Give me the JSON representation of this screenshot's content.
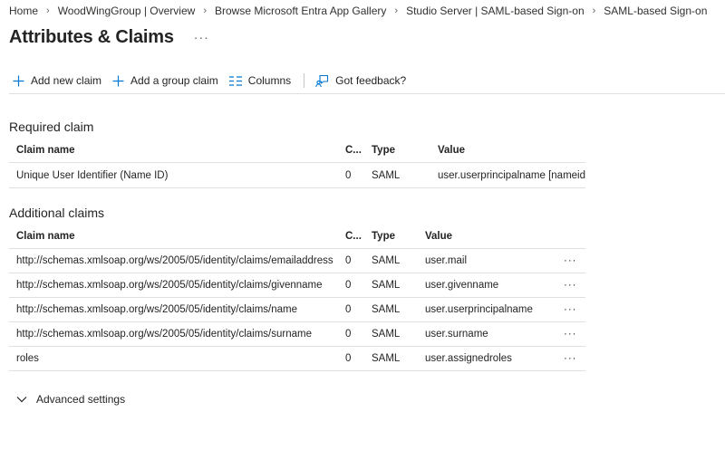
{
  "breadcrumb": [
    "Home",
    "WoodWingGroup | Overview",
    "Browse Microsoft Entra App Gallery",
    "Studio Server | SAML-based Sign-on",
    "SAML-based Sign-on"
  ],
  "page": {
    "title": "Attributes & Claims",
    "more": "···"
  },
  "toolbar": {
    "add_claim": "Add new claim",
    "add_group_claim": "Add a group claim",
    "columns": "Columns",
    "feedback": "Got feedback?"
  },
  "required": {
    "section_title": "Required claim",
    "headers": [
      "Claim name",
      "C...",
      "Type",
      "Value"
    ],
    "rows": [
      {
        "name": "Unique User Identifier (Name ID)",
        "c": "0",
        "type": "SAML",
        "value": "user.userprincipalname [nameid-format:emailAddress]"
      }
    ]
  },
  "additional": {
    "section_title": "Additional claims",
    "headers": [
      "Claim name",
      "C...",
      "Type",
      "Value"
    ],
    "row_more": "···",
    "rows": [
      {
        "name": "http://schemas.xmlsoap.org/ws/2005/05/identity/claims/emailaddress",
        "c": "0",
        "type": "SAML",
        "value": "user.mail"
      },
      {
        "name": "http://schemas.xmlsoap.org/ws/2005/05/identity/claims/givenname",
        "c": "0",
        "type": "SAML",
        "value": "user.givenname"
      },
      {
        "name": "http://schemas.xmlsoap.org/ws/2005/05/identity/claims/name",
        "c": "0",
        "type": "SAML",
        "value": "user.userprincipalname"
      },
      {
        "name": "http://schemas.xmlsoap.org/ws/2005/05/identity/claims/surname",
        "c": "0",
        "type": "SAML",
        "value": "user.surname"
      },
      {
        "name": "roles",
        "c": "0",
        "type": "SAML",
        "value": "user.assignedroles"
      }
    ]
  },
  "advanced": {
    "label": "Advanced settings"
  },
  "colors": {
    "accent": "#0078d4",
    "text": "#242424",
    "divider": "#e1dfdd"
  },
  "icons": {
    "add": "plus-icon",
    "columns": "columns-icon",
    "feedback": "feedback-icon",
    "chevron": "chevron-down-icon"
  }
}
